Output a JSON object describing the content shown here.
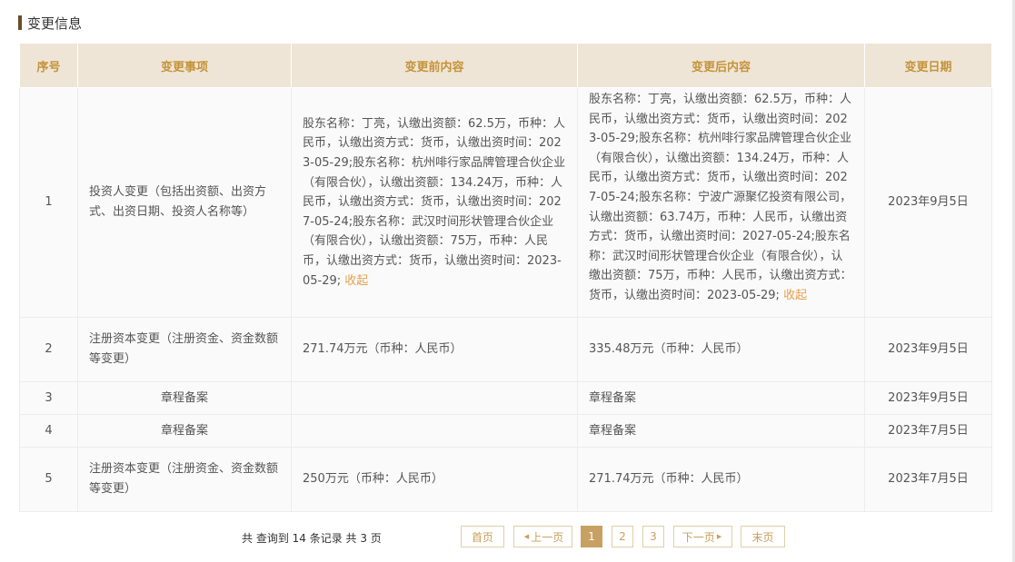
{
  "section": {
    "title": "变更信息"
  },
  "table": {
    "headers": {
      "idx": "序号",
      "item": "变更事项",
      "before": "变更前内容",
      "after": "变更后内容",
      "date": "变更日期"
    },
    "rows": [
      {
        "idx": "1",
        "item": "投资人变更（包括出资额、出资方式、出资日期、投资人名称等）",
        "before": "股东名称：丁亮，认缴出资额：62.5万，币种：人民币，认缴出资方式：货币，认缴出资时间：2023-05-29;股东名称：杭州啡行家品牌管理合伙企业（有限合伙），认缴出资额：134.24万，币种：人民币，认缴出资方式：货币，认缴出资时间：2027-05-24;股东名称：武汉时间形状管理合伙企业（有限合伙），认缴出资额：75万，币种：人民币，认缴出资方式：货币，认缴出资时间：2023-05-29;",
        "before_link": "收起",
        "after": "股东名称：丁亮，认缴出资额：62.5万，币种：人民币，认缴出资方式：货币，认缴出资时间：2023-05-29;股东名称：杭州啡行家品牌管理合伙企业（有限合伙），认缴出资额：134.24万，币种：人民币，认缴出资方式：货币，认缴出资时间：2027-05-24;股东名称：宁波广源聚亿投资有限公司，认缴出资额：63.74万，币种：人民币，认缴出资方式：货币，认缴出资时间：2027-05-24;股东名称：武汉时间形状管理合伙企业（有限合伙），认缴出资额：75万，币种：人民币，认缴出资方式：货币，认缴出资时间：2023-05-29;",
        "after_link": "收起",
        "date": "2023年9月5日"
      },
      {
        "idx": "2",
        "item": "注册资本变更（注册资金、资金数额等变更）",
        "before": "271.74万元（币种：人民币）",
        "after": "335.48万元（币种：人民币）",
        "date": "2023年9月5日"
      },
      {
        "idx": "3",
        "item": "章程备案",
        "before": "",
        "after": "章程备案",
        "date": "2023年9月5日"
      },
      {
        "idx": "4",
        "item": "章程备案",
        "before": "",
        "after": "章程备案",
        "date": "2023年7月5日"
      },
      {
        "idx": "5",
        "item": "注册资本变更（注册资金、资金数额等变更）",
        "before": "250万元（币种：人民币）",
        "after": "271.74万元（币种：人民币）",
        "date": "2023年7月5日"
      }
    ]
  },
  "pagination": {
    "summary": "共 查询到 14 条记录 共 3 页",
    "first": "首页",
    "prev": "上一页",
    "pages": [
      "1",
      "2",
      "3"
    ],
    "current": "1",
    "next": "下一页",
    "last": "末页"
  },
  "colors": {
    "accent": "#c9a063",
    "header_bg": "#efe5d6",
    "link": "#e5a04d"
  }
}
